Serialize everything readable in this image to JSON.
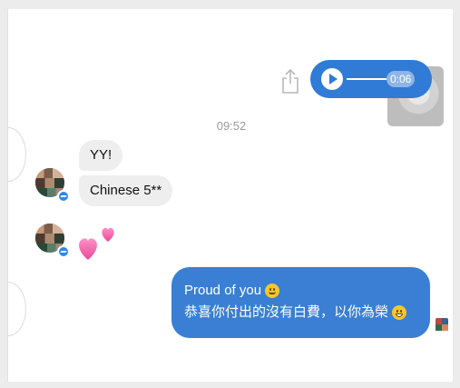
{
  "audio_message": {
    "duration": "0:06",
    "icons": {
      "play": "play-icon",
      "share": "share-icon"
    }
  },
  "timestamp": "09:52",
  "incoming": {
    "messages": [
      {
        "text": "YY!"
      },
      {
        "text": "Chinese 5**"
      }
    ],
    "reaction": "two-hearts-emoji"
  },
  "outgoing": {
    "lines": [
      {
        "text": "Proud of you",
        "emoji": "slightly-smiling-face"
      },
      {
        "text": "恭喜你付出的沒有白費，以你為榮",
        "emoji": "grinning-face"
      }
    ]
  },
  "colors": {
    "outgoing_bubble": "#3a7fd3",
    "incoming_bubble": "#eeeeee",
    "messenger_badge": "#2f86f0",
    "timestamp": "#9a9a9a"
  }
}
